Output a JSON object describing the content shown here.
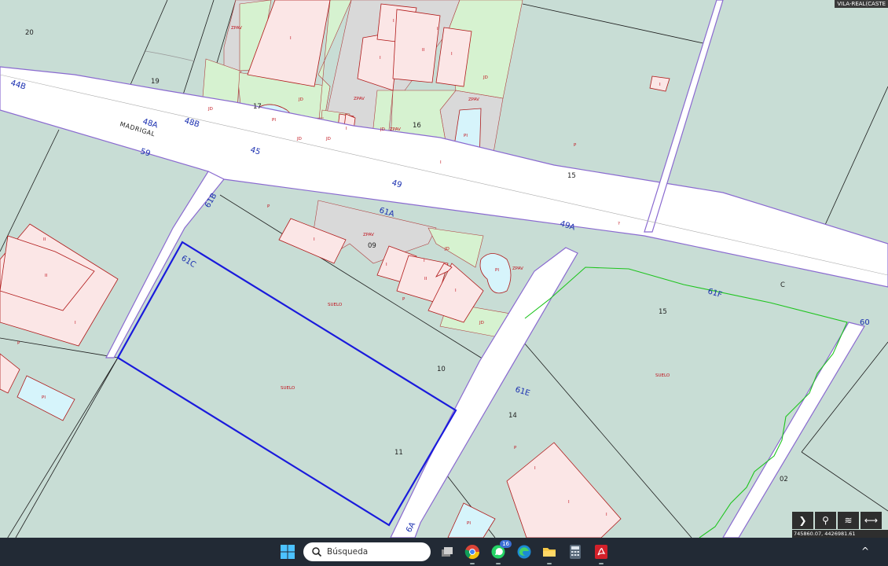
{
  "place_label": "VILA-REAL(CASTE",
  "street_name": "MADRIGAL",
  "parcel_numbers": [
    "20",
    "19",
    "17",
    "16",
    "15",
    "09",
    "10",
    "11",
    "14",
    "15",
    "02"
  ],
  "block_codes": [
    "44B",
    "48A",
    "48B",
    "45",
    "59",
    "49",
    "61B",
    "61A",
    "49A",
    "61C",
    "61F",
    "60",
    "61E",
    "6A"
  ],
  "street_letter": "C",
  "land_use_labels": [
    "ZPAV",
    "JD",
    "JD",
    "JD",
    "ZPAV",
    "JD",
    "JD",
    "JD",
    "ZPAV",
    "ZPAV",
    "JD",
    "JD",
    "ZPAV",
    "P",
    "P",
    "SUELO",
    "SUELO",
    "P",
    "SUELO",
    "P",
    "P",
    "P"
  ],
  "storey_labels": [
    "I",
    "I",
    "II",
    "I",
    "I",
    "I",
    "I",
    "I",
    "II",
    "I",
    "I",
    "I",
    "II",
    "I",
    "I",
    "II",
    "I",
    "I",
    "?",
    "I",
    "I",
    "I"
  ],
  "pool_label": "PI",
  "coordinates": "745860.07, 4426981.61",
  "map_tools": [
    {
      "name": "expand-tool-button",
      "icon": "chevron-right-icon",
      "glyph": "❯"
    },
    {
      "name": "zoom-tool-button",
      "icon": "magnifier-icon",
      "glyph": "⚲"
    },
    {
      "name": "layers-tool-button",
      "icon": "layers-icon",
      "glyph": "≋"
    },
    {
      "name": "measure-tool-button",
      "icon": "horizontal-arrows-icon",
      "glyph": "⟷"
    }
  ],
  "taskbar": {
    "search_placeholder": "Búsqueda",
    "whatsapp_badge": "16",
    "tray_chevron": "^"
  },
  "colors": {
    "parcel_fill": "#c8ddd5",
    "road_fill": "#ffffff",
    "boundary": "#8a6ad0",
    "garden_fill": "#d6f2d0",
    "building_fill": "#fbe6e6",
    "paved_fill": "#d9d9d9",
    "pool_fill": "#d6f4fb",
    "highlight_border": "#1a1adc",
    "taskbar_bg": "#222a35"
  }
}
